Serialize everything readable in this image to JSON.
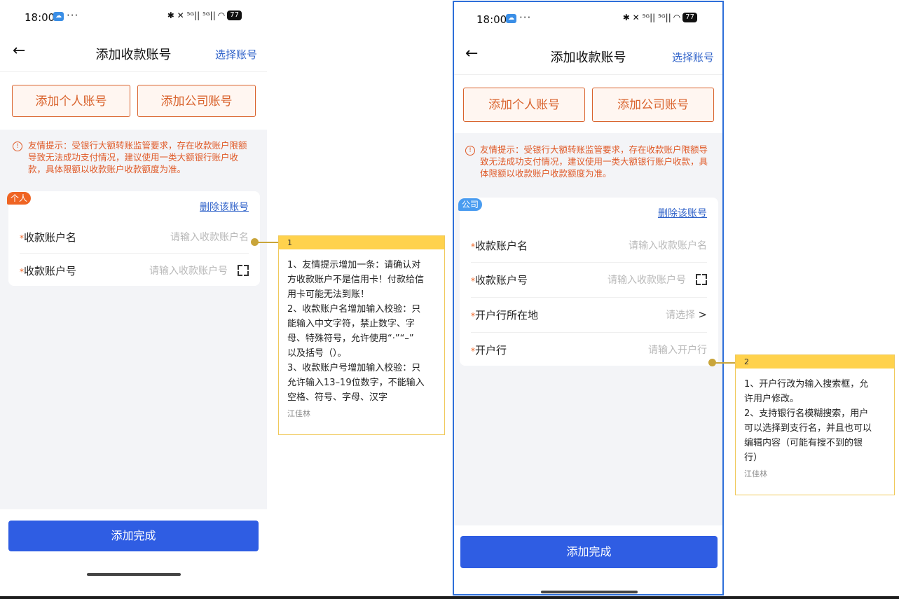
{
  "phone1": {
    "status": {
      "time": "18:00",
      "cloud_icon": "cloud-icon",
      "dots": "···",
      "signals": "✱ ✕ ⁵ᴳ|| ⁵ᴳ||",
      "wifi": "◠",
      "battery": "77"
    },
    "nav": {
      "title": "添加收款账号",
      "select_account": "选择账号"
    },
    "buttons": {
      "personal": "添加个人账号",
      "company": "添加公司账号"
    },
    "tip": "友情提示：受银行大额转账监管要求，存在收款账户限额导致无法成功支付情况，建议使用一类大额银行账户收款，具体限额以收款账户收款额度为准。",
    "card": {
      "tag": "个人",
      "delete": "删除该账号",
      "fields": [
        {
          "star": "*",
          "label": "收款账户名",
          "placeholder": "请输入收款账户名"
        },
        {
          "star": "*",
          "label": "收款账户号",
          "placeholder": "请输入收款账户号"
        }
      ]
    },
    "done": "添加完成"
  },
  "phone2": {
    "status": {
      "time": "18:00",
      "cloud_icon": "cloud-icon",
      "dots": "···",
      "signals": "✱ ✕ ⁵ᴳ|| ⁵ᴳ||",
      "wifi": "◠",
      "battery": "77"
    },
    "nav": {
      "title": "添加收款账号",
      "select_account": "选择账号"
    },
    "buttons": {
      "personal": "添加个人账号",
      "company": "添加公司账号"
    },
    "tip": "友情提示：受银行大额转账监管要求，存在收款账户限额导致无法成功支付情况，建议使用一类大额银行账户收款，具体限额以收款账户收款额度为准。",
    "card": {
      "tag": "公司",
      "delete": "删除该账号",
      "fields": [
        {
          "star": "*",
          "label": "收款账户名",
          "placeholder": "请输入收款账户名"
        },
        {
          "star": "*",
          "label": "收款账户号",
          "placeholder": "请输入收款账户号"
        },
        {
          "star": "*",
          "label": "开户行所在地",
          "placeholder": "请选择"
        },
        {
          "star": "*",
          "label": "开户行",
          "placeholder": "请输入开户行"
        }
      ]
    },
    "done": "添加完成"
  },
  "notes": [
    {
      "number": "1",
      "lines": [
        "1、友情提示增加一条：请确认对",
        "方收款账户不是信用卡！付款给信",
        "用卡可能无法到账！",
        "2、收款账户名增加输入校验：只",
        "能输入中文字符，禁止数字、字",
        "母、特殊符号，允许使用“·”“–”",
        "以及括号（）。",
        "3、收款账户号增加输入校验：只",
        "允许输入13–19位数字，不能输入",
        "空格、符号、字母、汉字"
      ],
      "author": "江佳林"
    },
    {
      "number": "2",
      "lines": [
        "1、开户行改为输入搜索框，允",
        "许用户修改。",
        "2、支持银行名模糊搜索，用户",
        "可以选择到支行名，并且也可以",
        "编辑内容（可能有搜不到的银",
        "行）"
      ],
      "author": "江佳林"
    }
  ],
  "colors": {
    "accent_orange": "#d9632d",
    "primary_blue": "#2f5de3",
    "link_blue": "#2f62c9",
    "note_yellow": "#ffd24d"
  }
}
